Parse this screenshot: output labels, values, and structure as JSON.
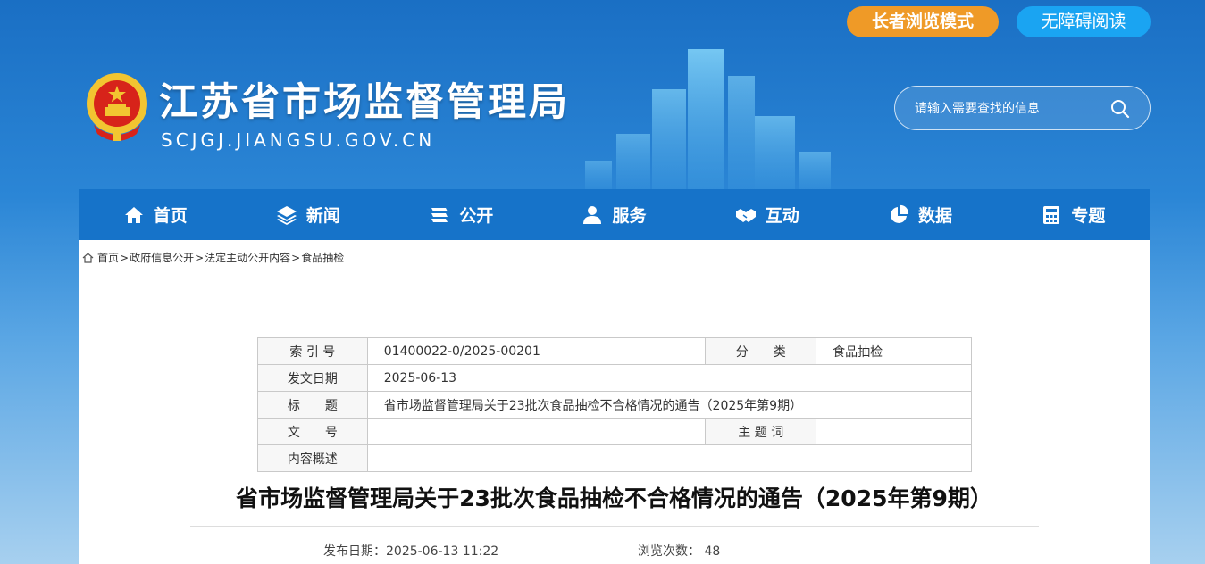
{
  "top_buttons": {
    "elder_mode": "长者浏览模式",
    "accessible": "无障碍阅读"
  },
  "header": {
    "site_title": "江苏省市场监督管理局",
    "site_url": "SCJGJ.JIANGSU.GOV.CN",
    "search_placeholder": "请输入需要查找的信息"
  },
  "nav": {
    "items": [
      {
        "label": "首页",
        "icon": "home-icon"
      },
      {
        "label": "新闻",
        "icon": "layers-icon"
      },
      {
        "label": "公开",
        "icon": "stack-icon"
      },
      {
        "label": "服务",
        "icon": "people-icon"
      },
      {
        "label": "互动",
        "icon": "handshake-icon"
      },
      {
        "label": "数据",
        "icon": "pie-chart-icon"
      },
      {
        "label": "专题",
        "icon": "calculator-icon"
      }
    ]
  },
  "breadcrumb": [
    "首页",
    "政府信息公开",
    "法定主动公开内容",
    "食品抽检"
  ],
  "meta_table": {
    "index_label": "索 引 号",
    "index_value": "01400022-0/2025-00201",
    "category_label": "分　　类",
    "category_value": "食品抽检",
    "date_label": "发文日期",
    "date_value": "2025-06-13",
    "title_label": "标　　题",
    "title_value": "省市场监督管理局关于23批次食品抽检不合格情况的通告（2025年第9期）",
    "docno_label": "文　　号",
    "docno_value": "",
    "keyword_label": "主 题 词",
    "keyword_value": "",
    "summary_label": "内容概述",
    "summary_value": ""
  },
  "article": {
    "title": "省市场监督管理局关于23批次食品抽检不合格情况的通告（2025年第9期）",
    "publish_date": "发布日期：2025-06-13 11:22",
    "views": "浏览次数： 48"
  },
  "colors": {
    "nav_bg": "#1673c9",
    "elder_btn": "#ef9a27",
    "access_btn": "#1aa4f2"
  }
}
